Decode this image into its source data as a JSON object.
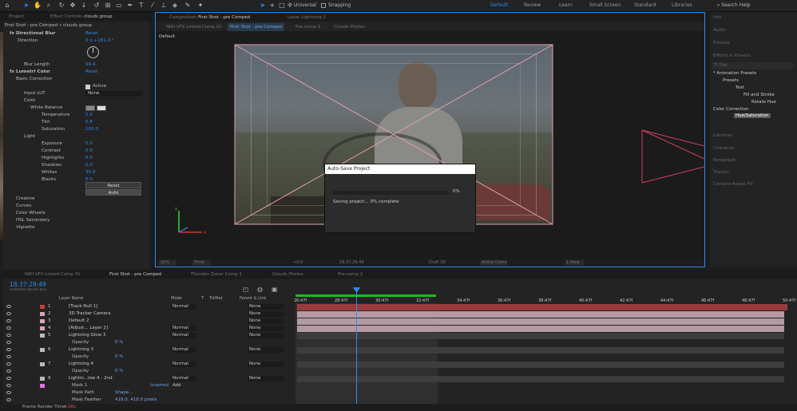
{
  "toolbar": {
    "snapping": "Snapping",
    "universal": "Universal",
    "workspaces": [
      "Default",
      "Review",
      "Learn",
      "Small Screen",
      "Standard",
      "Libraries"
    ],
    "search": "Search Help"
  },
  "project_tab": "Project",
  "effect_controls": {
    "tab": "Effect Controls clouds group",
    "breadcrumb": "First Shot - pre Comped • clouds group",
    "directional_blur": {
      "name": "Directional Blur",
      "reset": "Reset",
      "direction_label": "Direction",
      "direction_value": "0 x +181.0 °",
      "blur_label": "Blur Length",
      "blur_value": "99.4"
    },
    "lumetri": {
      "name": "Lumetri Color",
      "reset": "Reset",
      "basic": "Basic Correction",
      "active": "Active",
      "input_lut": "Input LUT",
      "lut_value": "None",
      "color": "Color",
      "white_balance": "White Balance",
      "temperature": "Temperature",
      "temperature_v": "1.2",
      "tint": "Tint",
      "tint_v": "0.8",
      "saturation": "Saturation",
      "saturation_v": "100.0",
      "light": "Light",
      "exposure": "Exposure",
      "exposure_v": "0.0",
      "contrast": "Contrast",
      "contrast_v": "0.0",
      "highlights": "Highlights",
      "highlights_v": "0.0",
      "shadows": "Shadows",
      "shadows_v": "0.0",
      "whites": "Whites",
      "whites_v": "35.0",
      "blacks": "Blacks",
      "blacks_v": "0.0",
      "reset_btn": "Reset",
      "auto_btn": "Auto",
      "creative": "Creative",
      "curves": "Curves",
      "color_wheels": "Color Wheels",
      "hsl": "HSL Secondary",
      "vignette": "Vignette"
    }
  },
  "composition": {
    "tab1": "Composition First Shot - pre Comped",
    "tab2": "Layer Lightning 2",
    "crumbs": [
      "NIKI VFX Linked Comp 01",
      "First Shot - pre Comped",
      "Pre-comp 3",
      "Clouds Photos"
    ],
    "view_label": "Default",
    "zoom": "25%",
    "quality": "Third",
    "timecode": "18:37:29:49",
    "exposure": "+0.0",
    "camera": "Active Camera",
    "views": "1 View",
    "draft": "Draft 3D"
  },
  "dialog": {
    "title": "Auto-Save Project",
    "percent": "0%",
    "progress": 0,
    "message": "Saving project... 0% complete"
  },
  "right_panel": {
    "sections": [
      "Info",
      "Audio",
      "Preview",
      "Effects & Presets"
    ],
    "search_placeholder": "Ƥ Flat",
    "tree": [
      "* Animation Presets",
      "Presets",
      "Text",
      "Fill and Stroke",
      "Rotate Hue"
    ],
    "color_correction": "Color Correction",
    "selected": "Hue/Saturation",
    "bottom_sections": [
      "Libraries",
      "Character",
      "Paragraph",
      "Tracker",
      "Content-Aware Fill"
    ]
  },
  "timeline": {
    "tabs": [
      "NIKI VFX Linked Comp 01",
      "First Shot - pre Comped",
      "Thunder Zoner Comp 1",
      "Clouds Photos",
      "Pre-comp 2"
    ],
    "timecode": "18:37:29:49",
    "fps": "1004949 (60.00 fps)",
    "headers": {
      "layer_name": "Layer Name",
      "mode": "Mode",
      "t": "T",
      "trkmat": "TrkMat",
      "parent": "Parent & Link"
    },
    "ticks": [
      "26:47f",
      "28:47f",
      "30:47f",
      "32:47f",
      "34:47f",
      "36:47f",
      "38:47f",
      "40:47f",
      "42:47f",
      "44:47f",
      "46:47f",
      "48:47f",
      "50:47f"
    ],
    "layers": [
      {
        "num": "1",
        "name": "[Track Null 1]",
        "mode": "Normal",
        "parent": "None",
        "color": "#c83c3c"
      },
      {
        "num": "2",
        "name": "3D Tracker Camera",
        "mode": "",
        "parent": "None",
        "color": "#d8a3b3"
      },
      {
        "num": "3",
        "name": "Default 2",
        "mode": "",
        "parent": "None",
        "color": "#d8a3b3"
      },
      {
        "num": "4",
        "name": "[Adjust... Layer 2]",
        "mode": "Normal",
        "parent": "None",
        "color": "#d8a3b3"
      },
      {
        "num": "5",
        "name": "Lightning Glow 3",
        "mode": "Normal",
        "parent": "None",
        "color": "#bbbbbb"
      },
      {
        "num": "",
        "name": "Opacity",
        "mode": "",
        "parent": "",
        "value": "0 %",
        "color": ""
      },
      {
        "num": "6",
        "name": "Lightning 3",
        "mode": "Normal",
        "parent": "None",
        "color": "#bbbbbb"
      },
      {
        "num": "",
        "name": "Opacity",
        "mode": "",
        "parent": "",
        "value": "0 %",
        "color": ""
      },
      {
        "num": "7",
        "name": "Lightning 4",
        "mode": "Normal",
        "parent": "None",
        "color": "#bbbbbb"
      },
      {
        "num": "",
        "name": "Opacity",
        "mode": "",
        "parent": "",
        "value": "0 %",
        "color": ""
      },
      {
        "num": "8",
        "name": "Lightni...low 4 - 2nd",
        "mode": "Normal",
        "parent": "None",
        "color": "#bbbbbb"
      },
      {
        "num": "",
        "name": "Mask 1",
        "mode": "Add",
        "parent": "",
        "value": "Inverted",
        "color": "#e070e0"
      },
      {
        "num": "",
        "name": "Mask Path",
        "mode": "",
        "parent": "",
        "value": "Shape...",
        "color": ""
      },
      {
        "num": "",
        "name": "Mask Feather",
        "mode": "",
        "parent": "",
        "value": "418.0, 418.0 pixels",
        "color": ""
      }
    ],
    "render_time": "Frame Render Time:",
    "render_value": "4.06s"
  }
}
